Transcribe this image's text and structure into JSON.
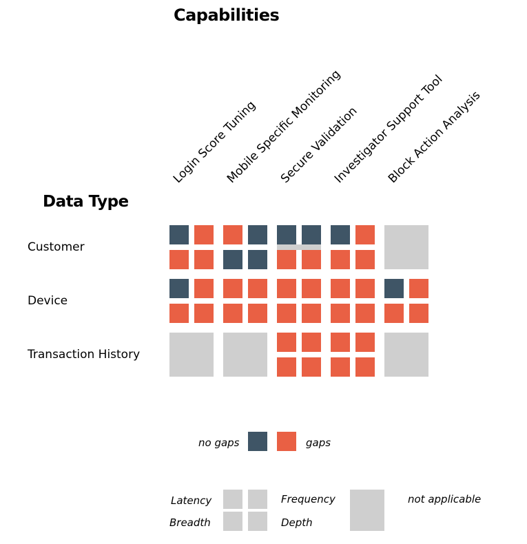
{
  "chart_data": {
    "type": "heatmap",
    "title": "Capabilities",
    "row_header": "Data Type",
    "columns": [
      "Login Score Tuning",
      "Mobile Specific Monitoring",
      "Secure Validation",
      "Investigator Support Tool",
      "Block Action Analysis"
    ],
    "rows": [
      "Customer",
      "Device",
      "Transaction History"
    ],
    "quadrant_order": [
      "Latency",
      "Frequency",
      "Breadth",
      "Depth"
    ],
    "cells": [
      [
        {
          "status": [
            "no gaps",
            "gaps",
            "gaps",
            "gaps"
          ]
        },
        {
          "status": [
            "gaps",
            "no gaps",
            "no gaps",
            "no gaps"
          ]
        },
        {
          "status": [
            "no gaps",
            "no gaps",
            "gaps",
            "gaps"
          ]
        },
        {
          "status": [
            "no gaps",
            "gaps",
            "gaps",
            "gaps"
          ]
        },
        {
          "status": "not applicable"
        }
      ],
      [
        {
          "status": [
            "no gaps",
            "gaps",
            "gaps",
            "gaps"
          ]
        },
        {
          "status": [
            "gaps",
            "gaps",
            "gaps",
            "gaps"
          ]
        },
        {
          "status": [
            "gaps",
            "gaps",
            "gaps",
            "gaps"
          ]
        },
        {
          "status": [
            "gaps",
            "gaps",
            "gaps",
            "gaps"
          ]
        },
        {
          "status": [
            "no gaps",
            "gaps",
            "gaps",
            "gaps"
          ]
        }
      ],
      [
        {
          "status": "not applicable"
        },
        {
          "status": "not applicable"
        },
        {
          "status": [
            "gaps",
            "gaps",
            "gaps",
            "gaps"
          ]
        },
        {
          "status": [
            "gaps",
            "gaps",
            "gaps",
            "gaps"
          ]
        },
        {
          "status": "not applicable"
        }
      ]
    ],
    "legend": {
      "no_gaps_label": "no gaps",
      "gaps_label": "gaps",
      "quadrant_labels": [
        "Latency",
        "Frequency",
        "Breadth",
        "Depth"
      ],
      "not_applicable_label": "not applicable"
    },
    "colors": {
      "no gaps": "#3f5566",
      "gaps": "#e96044",
      "not applicable": "#cfcfcf"
    }
  }
}
